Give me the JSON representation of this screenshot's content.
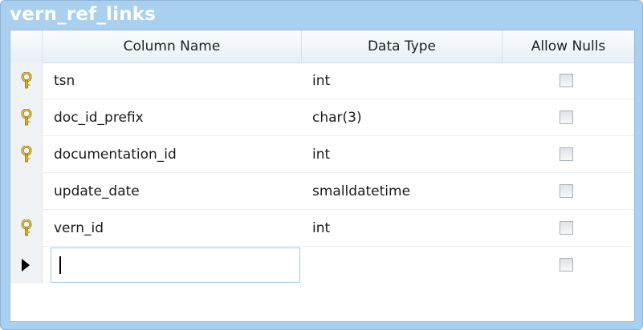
{
  "table": {
    "name": "vern_ref_links",
    "columns_header": {
      "column_name": "Column Name",
      "data_type": "Data Type",
      "allow_nulls": "Allow Nulls"
    },
    "rows": [
      {
        "key": true,
        "name": "tsn",
        "type": "int",
        "allow_nulls": false
      },
      {
        "key": true,
        "name": "doc_id_prefix",
        "type": "char(3)",
        "allow_nulls": false
      },
      {
        "key": true,
        "name": "documentation_id",
        "type": "int",
        "allow_nulls": false
      },
      {
        "key": false,
        "name": "update_date",
        "type": "smalldatetime",
        "allow_nulls": false
      },
      {
        "key": true,
        "name": "vern_id",
        "type": "int",
        "allow_nulls": false
      }
    ],
    "new_row": {
      "name": "",
      "type": "",
      "allow_nulls": false
    }
  },
  "icons": {
    "primary_key": "key-icon",
    "current_row": "row-pointer-icon"
  },
  "colors": {
    "title_bar": "#a9d0ee",
    "key_icon": "#e2b32a"
  }
}
